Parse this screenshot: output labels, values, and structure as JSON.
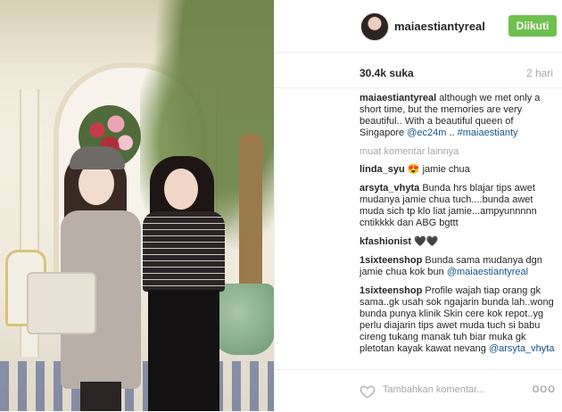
{
  "post": {
    "username": "maiaestiantyreal",
    "follow_label": "Diikuti",
    "likes": "30.4k suka",
    "time_ago": "2 hari"
  },
  "caption": {
    "username": "maiaestiantyreal",
    "text": "although we met only a short time, but the memories are very beautiful.. With a beautiful queen of Singapore",
    "mention": "@ec24m",
    "sep": "..",
    "hashtag": "#maiaestianty"
  },
  "more_comments_label": "muat komentar lainnya",
  "comments": [
    {
      "user": "linda_syu",
      "emoji": "😍",
      "text": "jamie chua"
    },
    {
      "user": "arsyta_vhyta",
      "text": "Bunda hrs blajar tips awet mudanya jamie chua tuch....bunda awet muda sich tp klo liat jamie...ampyunnnnn cntikkkk dan ABG bgttt"
    },
    {
      "user": "kfashionist",
      "text": "🖤🖤"
    },
    {
      "user": "1sixteenshop",
      "text": "Bunda sama mudanya dgn jamie chua kok bun",
      "mention": "@maiaestiantyreal"
    },
    {
      "user": "1sixteenshop",
      "text": "Profile wajah tiap orang gk sama..gk usah sok ngajarin bunda lah..wong bunda punya klinik Skin cere kok repot..yg perlu diajarin tips awet muda tuch si babu cireng tukang manak tuh biar muka gk pletotan kayak kawat nevang",
      "mention": "@arsyta_vhyta"
    }
  ],
  "footer": {
    "comment_placeholder": "Tambahkan komentar...",
    "more_icon": "ooo"
  },
  "colors": {
    "follow_button": "#70c050",
    "link": "#125688",
    "muted": "#a5a7aa"
  }
}
